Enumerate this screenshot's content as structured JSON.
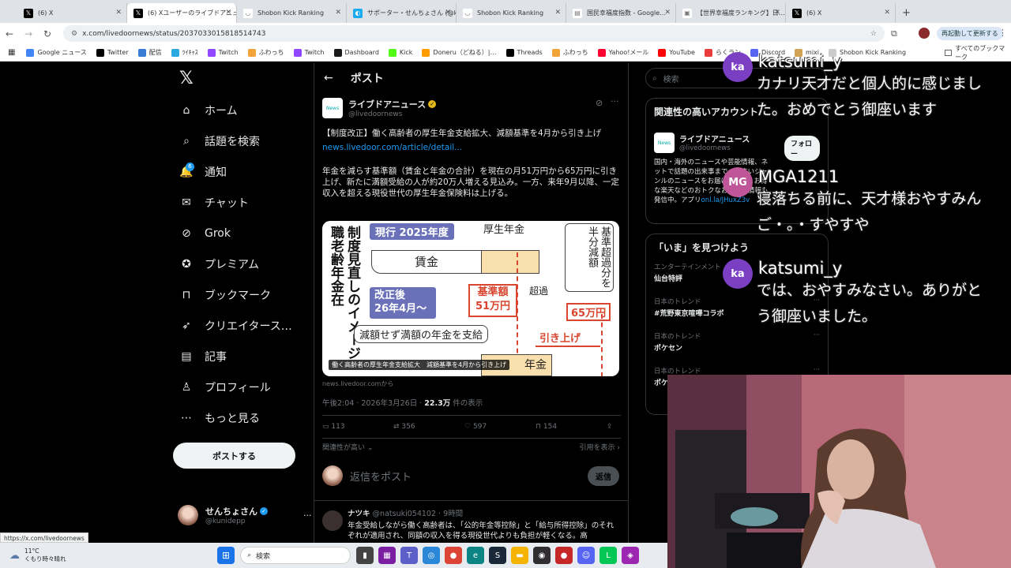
{
  "browser": {
    "tabs": [
      {
        "title": "(6) X",
        "color": "#000000",
        "glyph": "𝕏"
      },
      {
        "title": "(6) Xユーザーのライブドアニュ…",
        "color": "#000000",
        "glyph": "𝕏",
        "active": true
      },
      {
        "title": "Shobon Kick Ranking",
        "color": "#ffffff",
        "glyph": "◡"
      },
      {
        "title": "サポーター・せんちょさん (@k…",
        "color": "#19aaf0",
        "glyph": "◐"
      },
      {
        "title": "Shobon Kick Ranking",
        "color": "#ffffff",
        "glyph": "◡"
      },
      {
        "title": "国民幸福度指数 - Google…",
        "color": "#ffffff",
        "glyph": "▤"
      },
      {
        "title": "【世界幸福度ランキング】日…",
        "color": "#ffffff",
        "glyph": "▣"
      },
      {
        "title": "(6) X",
        "color": "#000000",
        "glyph": "𝕏"
      }
    ],
    "new_tab": "+",
    "url": "x.com/livedoornews/status/2037033015818514743",
    "restart_label": "再起動して更新する",
    "bookmarks": [
      {
        "label": "Google ニュース",
        "color": "#4285f4"
      },
      {
        "label": "Twitter",
        "color": "#000000"
      },
      {
        "label": "配信",
        "color": "#3a7bd5"
      },
      {
        "label": "ﾂｲｷｬｽ",
        "color": "#2aa8e0"
      },
      {
        "label": "Twitch",
        "color": "#9146ff"
      },
      {
        "label": "ふわっち",
        "color": "#f2a33a"
      },
      {
        "label": "Twitch",
        "color": "#9146ff"
      },
      {
        "label": "Dashboard",
        "color": "#1a1a1a"
      },
      {
        "label": "Kick",
        "color": "#53fc18"
      },
      {
        "label": "Doneru（どねる）|…",
        "color": "#ff9d00"
      },
      {
        "label": "Threads",
        "color": "#000000"
      },
      {
        "label": "ふわっち",
        "color": "#f2a33a"
      },
      {
        "label": "Yahoo!メール",
        "color": "#ff0033"
      },
      {
        "label": "YouTube",
        "color": "#ff0000"
      },
      {
        "label": "らくラン",
        "color": "#e93c3c"
      },
      {
        "label": "Discord",
        "color": "#5865f2"
      },
      {
        "label": "mixi",
        "color": "#d1a352"
      },
      {
        "label": "Shobon Kick Ranking",
        "color": "#cccccc"
      }
    ],
    "all_bookmarks": "すべてのブックマーク"
  },
  "nav": {
    "items": [
      {
        "label": "ホーム",
        "icon": "home-icon"
      },
      {
        "label": "話題を検索",
        "icon": "search-icon"
      },
      {
        "label": "通知",
        "icon": "bell-icon",
        "badge": "6"
      },
      {
        "label": "チャット",
        "icon": "mail-icon"
      },
      {
        "label": "Grok",
        "icon": "grok-icon"
      },
      {
        "label": "プレミアム",
        "icon": "verified-icon"
      },
      {
        "label": "ブックマーク",
        "icon": "bookmark-icon"
      },
      {
        "label": "クリエイタース…",
        "icon": "rocket-icon"
      },
      {
        "label": "記事",
        "icon": "article-icon"
      },
      {
        "label": "プロフィール",
        "icon": "person-icon"
      },
      {
        "label": "もっと見る",
        "icon": "more-icon"
      }
    ],
    "post_button": "ポストする",
    "account_name": "せんちょさん",
    "account_handle": "@kunidepp"
  },
  "post": {
    "header": "ポスト",
    "author": "ライブドアニュース",
    "handle": "@livedoornews",
    "text1": "【制度改正】働く高齢者の厚生年金支給拡大、減額基準を4月から引き上げ",
    "link": "news.livedoor.com/article/detail...",
    "text2": "年金を減らす基準額（賃金と年金の合計）を現在の月51万円から65万円に引き上げ、新たに満額受給の人が約20万人増える見込み。一方、来年9月以降、一定収入を超える現役世代の厚生年金保険料は上げる。",
    "image_caption": "働く高齢者の厚生年金支給拡大　減額基準を4月から引き上げ",
    "source": "news.livedoor.comから",
    "time": "午後2:04 · 2026年3月26日 · ",
    "views": "22.3万",
    "views_suffix": " 件の表示",
    "replies": "113",
    "reposts": "356",
    "likes": "597",
    "bookmarks": "154",
    "sort_left": "関連性が高い",
    "sort_right": "引用を表示",
    "reply_placeholder": "返信をポスト",
    "reply_button": "返信"
  },
  "figure": {
    "vertical_title": "制度見直しのイメージ職老齢年金在",
    "current_label": "現行 2025年度",
    "pension_label": "厚生年金",
    "wage_label": "賃金",
    "reduce_note": "基準超過分を半分減額",
    "exceed_label": "超過",
    "revised_label": "改正後\n26年4月～",
    "base_label": "基準額\n51万円",
    "new_base": "65万円",
    "full_label": "減額せず満額の年金を支給",
    "raise_label": "引き上げ",
    "pension2": "年金"
  },
  "reply": {
    "name": "ナツキ",
    "handle": "@natsuki054102",
    "time": "9時間",
    "text": "年金受給しながら働く高齢者は、「公的年金等控除」と「給与所得控除」のそれぞれが適用され、同額の収入を得る現役世代よりも負担が軽くなる。高"
  },
  "right": {
    "search_placeholder": "検索",
    "related_title": "関連性の高いアカウント",
    "acct_name": "ライブドアニュース",
    "acct_handle": "@livedoornews",
    "follow": "フォロー",
    "acct_bio": "国内・海外のニュースや芸能情報、ネットで話題の出来事まで、幅広いジャンルのニュースをお届け。また、お得な楽天などのおトクなお買い物情報も発信中。アプリ",
    "acct_link": "onl.la/JHuxZ3v",
    "trends_title": "「いま」を見つけよう",
    "trends": [
      {
        "cat": "エンターテインメント",
        "name": "仙台特評"
      },
      {
        "cat": "日本のトレンド",
        "name": "#荒野東京喧嘩コラボ"
      },
      {
        "cat": "日本のトレンド",
        "name": "ポケセン"
      },
      {
        "cat": "日本のトレンド",
        "name": "ポケ"
      }
    ]
  },
  "chat": [
    {
      "avatar": "ka",
      "avatar_color": "#7b3fc4",
      "name": "katsumi_y",
      "msg": "カナリ天才だと個人的に感じました。おめでとう御座います"
    },
    {
      "avatar": "MG",
      "avatar_color": "#c0569a",
      "name": "MGA1211",
      "msg": "寝落ちる前に、天才様おやすみんご・。・すやすや"
    },
    {
      "avatar": "ka",
      "avatar_color": "#7b3fc4",
      "name": "katsumi_y",
      "msg": "では、おやすみなさい。ありがとう御座いました。"
    }
  ],
  "status_url": "https://x.com/livedoornews",
  "taskbar": {
    "weather_temp": "11°C",
    "weather_desc": "くもり時々晴れ",
    "search": "検索"
  }
}
